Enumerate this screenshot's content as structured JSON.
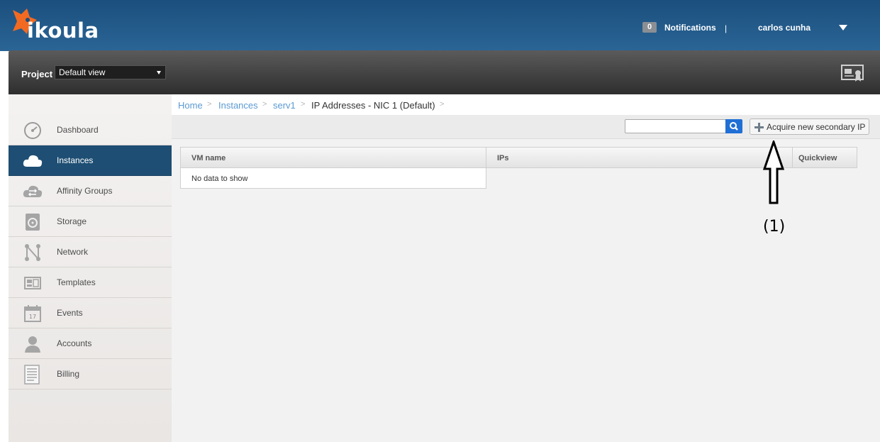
{
  "header": {
    "logo_text": "ikoula",
    "notifications_count": "0",
    "notifications_label": "Notifications",
    "separator": "|",
    "user_name": "carlos cunha"
  },
  "project_bar": {
    "label": "Project",
    "selected": "Default view"
  },
  "sidebar": {
    "items": [
      {
        "label": "Dashboard",
        "icon": "dashboard-icon",
        "active": false
      },
      {
        "label": "Instances",
        "icon": "cloud-icon",
        "active": true
      },
      {
        "label": "Affinity Groups",
        "icon": "affinity-icon",
        "active": false
      },
      {
        "label": "Storage",
        "icon": "storage-icon",
        "active": false
      },
      {
        "label": "Network",
        "icon": "network-icon",
        "active": false
      },
      {
        "label": "Templates",
        "icon": "templates-icon",
        "active": false
      },
      {
        "label": "Events",
        "icon": "calendar-icon",
        "active": false
      },
      {
        "label": "Accounts",
        "icon": "user-icon",
        "active": false
      },
      {
        "label": "Billing",
        "icon": "document-icon",
        "active": false
      }
    ]
  },
  "breadcrumb": {
    "items": [
      "Home",
      "Instances",
      "serv1",
      "IP Addresses - NIC 1 (Default)"
    ]
  },
  "toolbar": {
    "search_value": "",
    "acquire_label": "Acquire new secondary IP"
  },
  "table": {
    "columns": [
      "VM name",
      "IPs",
      "Quickview"
    ],
    "empty_text": "No data to show"
  },
  "annotation": {
    "label": "(1)"
  },
  "colors": {
    "header_blue": "#1b4f7d",
    "active_nav": "#1e4e73",
    "link_blue": "#5b9ad1",
    "logo_orange": "#f26a21"
  }
}
